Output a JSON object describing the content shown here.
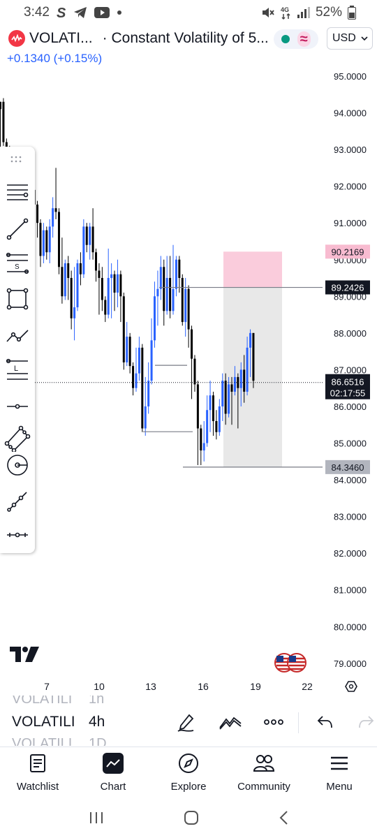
{
  "status_bar": {
    "time": "3:42",
    "network": "4G",
    "battery": "52%"
  },
  "header": {
    "symbol_short": "VOLATI...",
    "symbol_description": "· Constant Volatility of 5...",
    "change": "+0.1340 (+0.15%)",
    "currency": "USD"
  },
  "chart_data": {
    "type": "candlestick",
    "price_axis": [
      "95.0000",
      "94.0000",
      "93.0000",
      "92.0000",
      "91.0000",
      "90.0000",
      "89.0000",
      "88.0000",
      "87.0000",
      "86.0000",
      "85.0000",
      "84.0000",
      "83.0000",
      "82.0000",
      "81.0000",
      "80.0000",
      "79.0000"
    ],
    "ylim": [
      78.6,
      95.6
    ],
    "date_axis": [
      "7",
      "10",
      "13",
      "16",
      "19",
      "22"
    ],
    "last_price": "86.6516",
    "countdown": "02:17:55",
    "position_tool": {
      "target": "90.2169",
      "entry": "89.2426",
      "stop": "84.3460",
      "target_value": 90.2169,
      "entry_value": 89.2426,
      "stop_value": 84.346
    },
    "candles": [
      [
        94.3,
        94.1,
        94.3,
        93.0
      ],
      [
        94.3,
        93.2,
        94.4,
        93.1
      ],
      [
        93.2,
        93.0,
        93.3,
        92.5
      ],
      [
        93.0,
        92.2,
        93.1,
        92.0
      ],
      [
        92.2,
        91.8,
        92.6,
        91.4
      ],
      [
        91.8,
        92.8,
        93.0,
        91.6
      ],
      [
        92.8,
        91.9,
        93.0,
        91.7
      ],
      [
        91.9,
        92.2,
        92.4,
        91.5
      ],
      [
        92.2,
        91.7,
        92.3,
        91.2
      ],
      [
        91.7,
        91.6,
        91.9,
        90.8
      ],
      [
        91.6,
        91.9,
        92.1,
        91.3
      ],
      [
        91.9,
        91.5,
        92.2,
        91.2
      ],
      [
        91.5,
        91.0,
        91.6,
        90.6
      ],
      [
        91.0,
        90.1,
        91.1,
        89.8
      ],
      [
        90.1,
        90.8,
        91.0,
        89.9
      ],
      [
        90.8,
        90.2,
        90.9,
        90.0
      ],
      [
        90.2,
        90.9,
        91.1,
        89.9
      ],
      [
        90.9,
        91.4,
        91.7,
        90.6
      ],
      [
        91.4,
        91.3,
        92.5,
        91.1
      ],
      [
        91.3,
        89.8,
        91.4,
        89.6
      ],
      [
        89.8,
        89.0,
        90.6,
        88.8
      ],
      [
        89.0,
        89.9,
        90.0,
        88.9
      ],
      [
        89.9,
        89.5,
        90.1,
        88.9
      ],
      [
        89.5,
        88.4,
        89.7,
        88.1
      ],
      [
        88.4,
        88.7,
        89.8,
        87.8
      ],
      [
        88.7,
        89.9,
        90.0,
        88.6
      ],
      [
        89.9,
        89.6,
        90.2,
        89.3
      ],
      [
        89.6,
        90.9,
        91.1,
        89.5
      ],
      [
        90.9,
        90.4,
        91.0,
        90.2
      ],
      [
        90.4,
        90.9,
        91.0,
        90.0
      ],
      [
        90.9,
        90.2,
        91.4,
        90.0
      ],
      [
        90.2,
        89.7,
        90.3,
        89.4
      ],
      [
        89.7,
        89.5,
        89.9,
        88.5
      ],
      [
        89.5,
        88.9,
        89.8,
        88.6
      ],
      [
        88.9,
        88.5,
        89.0,
        88.3
      ],
      [
        88.5,
        89.5,
        90.3,
        88.4
      ],
      [
        89.5,
        89.6,
        89.9,
        88.4
      ],
      [
        89.6,
        89.1,
        89.7,
        88.6
      ],
      [
        89.1,
        89.6,
        90.0,
        88.7
      ],
      [
        89.6,
        89.0,
        89.7,
        88.3
      ],
      [
        89.0,
        87.2,
        89.1,
        87.0
      ],
      [
        87.2,
        87.9,
        88.3,
        87.1
      ],
      [
        87.9,
        87.1,
        88.0,
        86.9
      ],
      [
        87.1,
        86.5,
        87.2,
        86.3
      ],
      [
        86.5,
        86.9,
        87.6,
        86.4
      ],
      [
        86.9,
        87.6,
        87.9,
        86.7
      ],
      [
        87.6,
        85.4,
        87.7,
        85.3
      ],
      [
        85.4,
        86.0,
        86.8,
        85.2
      ],
      [
        86.0,
        86.7,
        87.2,
        85.8
      ],
      [
        86.7,
        87.8,
        88.4,
        86.6
      ],
      [
        87.8,
        89.0,
        89.4,
        87.6
      ],
      [
        89.0,
        89.2,
        89.7,
        88.2
      ],
      [
        89.2,
        89.8,
        90.1,
        88.9
      ],
      [
        89.8,
        88.6,
        90.0,
        88.2
      ],
      [
        88.6,
        89.5,
        90.1,
        88.5
      ],
      [
        89.5,
        88.6,
        90.1,
        88.4
      ],
      [
        88.6,
        89.2,
        90.4,
        88.5
      ],
      [
        89.2,
        90.0,
        90.1,
        89.0
      ],
      [
        90.0,
        89.5,
        90.1,
        89.1
      ],
      [
        89.5,
        88.3,
        89.6,
        88.2
      ],
      [
        88.3,
        89.2,
        89.5,
        87.9
      ],
      [
        89.2,
        88.1,
        89.3,
        87.6
      ],
      [
        88.1,
        87.3,
        88.2,
        86.2
      ],
      [
        87.3,
        86.6,
        87.4,
        86.4
      ],
      [
        86.6,
        85.4,
        86.7,
        84.4
      ],
      [
        85.4,
        84.8,
        85.5,
        84.4
      ],
      [
        84.8,
        85.0,
        85.6,
        84.5
      ],
      [
        85.0,
        85.9,
        86.3,
        84.9
      ],
      [
        85.9,
        86.3,
        86.7,
        85.3
      ],
      [
        86.3,
        85.6,
        86.4,
        85.2
      ],
      [
        85.6,
        85.3,
        85.9,
        85.1
      ],
      [
        85.3,
        86.0,
        86.2,
        85.2
      ],
      [
        86.0,
        86.7,
        86.9,
        85.6
      ],
      [
        86.7,
        85.8,
        86.9,
        85.5
      ],
      [
        85.8,
        86.6,
        86.8,
        85.7
      ],
      [
        86.6,
        86.4,
        86.8,
        85.5
      ],
      [
        86.4,
        86.8,
        87.1,
        86.3
      ],
      [
        86.8,
        86.5,
        86.9,
        85.4
      ],
      [
        86.5,
        87.0,
        87.2,
        86.0
      ],
      [
        87.0,
        86.4,
        87.4,
        86.1
      ],
      [
        86.4,
        87.6,
        87.9,
        86.3
      ],
      [
        87.6,
        88.0,
        88.1,
        86.8
      ],
      [
        88.0,
        86.7,
        88.0,
        86.5
      ]
    ]
  },
  "toolbar_tools": [
    "horizontal-lines-tool",
    "trend-line-tool",
    "fib-retracement-tool",
    "rectangle-tool",
    "path-tool",
    "long-position-tool",
    "horizontal-line-tool",
    "polygon-tool",
    "circle-tool",
    "pattern-tool",
    "measure-tool"
  ],
  "bottom_bar": {
    "picker_prev": {
      "symbol": "VOLATILI",
      "interval": "1h"
    },
    "picker_current": {
      "symbol": "VOLATILI",
      "interval": "4h"
    },
    "picker_next": {
      "symbol": "VOLATILI",
      "interval": "1D"
    }
  },
  "nav": [
    {
      "label": "Watchlist",
      "icon": "watchlist-icon"
    },
    {
      "label": "Chart",
      "icon": "chart-icon"
    },
    {
      "label": "Explore",
      "icon": "compass-icon"
    },
    {
      "label": "Community",
      "icon": "community-icon"
    },
    {
      "label": "Menu",
      "icon": "hamburger-icon"
    }
  ],
  "colors": {
    "bull": "#2962ff",
    "bear": "#000000",
    "target_zone": "#f8bbd0",
    "stop_zone": "#e8e8e8",
    "accent": "#2962ff"
  }
}
